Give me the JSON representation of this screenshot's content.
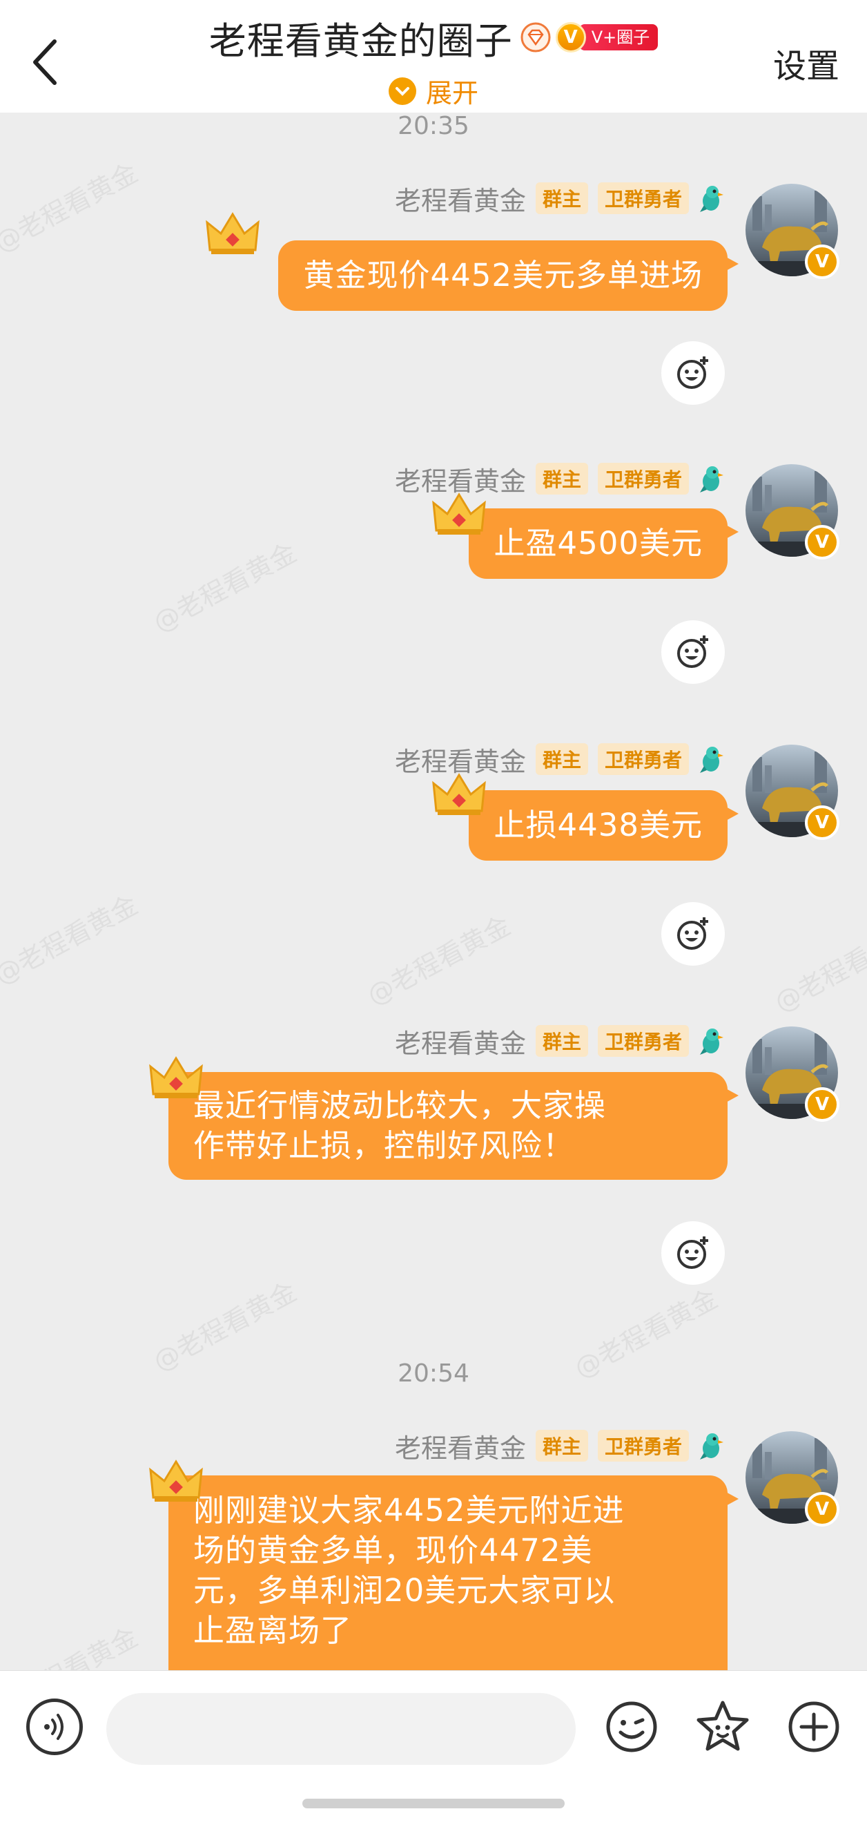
{
  "header": {
    "title": "老程看黄金的圈子",
    "vip_letter": "V",
    "vip_tag": "V+圈子",
    "expand_label": "展开",
    "settings_label": "设置"
  },
  "watermark": "@老程看黄金",
  "messages": [
    {
      "time": "20:35",
      "sender": "老程看黄金",
      "badge_owner": "群主",
      "badge_brave": "卫群勇者",
      "text": "黄金现价4452美元多单进场"
    },
    {
      "sender": "老程看黄金",
      "badge_owner": "群主",
      "badge_brave": "卫群勇者",
      "text": "止盈4500美元"
    },
    {
      "sender": "老程看黄金",
      "badge_owner": "群主",
      "badge_brave": "卫群勇者",
      "text": "止损4438美元"
    },
    {
      "sender": "老程看黄金",
      "badge_owner": "群主",
      "badge_brave": "卫群勇者",
      "line1": "最近行情波动比较大，大家操",
      "line2": "作带好止损，控制好风险！"
    },
    {
      "time": "20:54",
      "sender": "老程看黄金",
      "badge_owner": "群主",
      "badge_brave": "卫群勇者",
      "line1": "刚刚建议大家4452美元附近进",
      "line2": "场的黄金多单，现价4472美",
      "line3": "元，多单利润20美元大家可以",
      "line4": "止盈离场了"
    }
  ],
  "avatar_verified": "V",
  "composer": {
    "placeholder": ""
  },
  "colors": {
    "accent": "#fc9b33",
    "brand": "#f08a00",
    "badge_bg": "#fbe7c6"
  }
}
